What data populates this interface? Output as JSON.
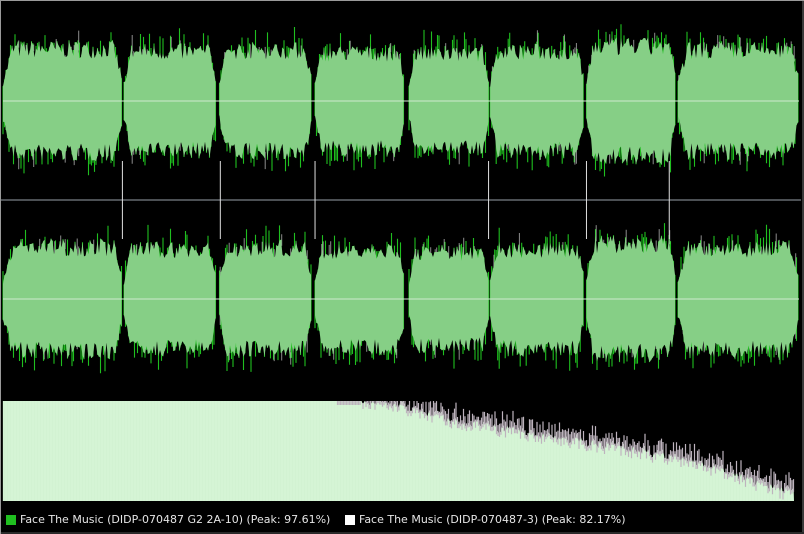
{
  "colors": {
    "background": "#000000",
    "track1": "#1fbf1f",
    "track1_fill": "#86cf86",
    "track2": "#ffffff",
    "spectrum_fill": "#d8f5d8",
    "spectrum_overlay": "#bdb3bd",
    "center_line": "#cfe8cf",
    "divider": "#7a7f86"
  },
  "legend": {
    "track1_label": "Face The Music (DIDP-070487 G2 2A-10) (Peak: 97.61%)",
    "track2_label": "Face The Music (DIDP-070487-3) (Peak: 82.17%)"
  },
  "waveform": {
    "channels": [
      "left",
      "right"
    ],
    "segments": [
      {
        "start": 0.0,
        "end": 0.15,
        "level": 0.78
      },
      {
        "start": 0.152,
        "end": 0.268,
        "level": 0.74
      },
      {
        "start": 0.272,
        "end": 0.388,
        "level": 0.76
      },
      {
        "start": 0.392,
        "end": 0.505,
        "level": 0.72
      },
      {
        "start": 0.51,
        "end": 0.61,
        "level": 0.7
      },
      {
        "start": 0.612,
        "end": 0.73,
        "level": 0.74
      },
      {
        "start": 0.733,
        "end": 0.845,
        "level": 0.82
      },
      {
        "start": 0.848,
        "end": 1.0,
        "level": 0.76
      }
    ],
    "markers": [
      0.15,
      0.273,
      0.392,
      0.61,
      0.733,
      0.837
    ]
  },
  "spectrum": {
    "profile": [
      1.0,
      1.0,
      1.0,
      1.0,
      1.0,
      1.0,
      1.0,
      1.0,
      1.0,
      1.0,
      1.0,
      0.95,
      0.85,
      0.78,
      0.72,
      0.66,
      0.6,
      0.55,
      0.48,
      0.4,
      0.3,
      0.18,
      0.06
    ]
  }
}
